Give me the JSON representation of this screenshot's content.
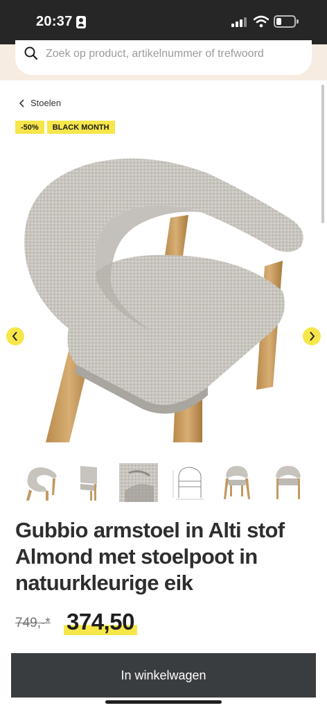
{
  "status_bar": {
    "time": "20:37"
  },
  "search": {
    "placeholder": "Zoek op product, artikelnummer of trefwoord"
  },
  "breadcrumb": {
    "label": "Stoelen"
  },
  "badges": {
    "discount": "-50%",
    "campaign": "BLACK MONTH"
  },
  "gallery": {
    "image_alt": "Gubbio armstoel",
    "thumbnail_count": 6,
    "thumbnails": [
      "chair-front-angle",
      "chair-side-cropped",
      "fabric-closeup",
      "chair-dimension-sketch",
      "chair-front-wide",
      "chair-front-straight"
    ]
  },
  "product": {
    "title": "Gubbio armstoel in Alti stof Almond met stoelpoot in natuurkleurige eik",
    "old_price": "749,-*",
    "new_price": "374,50"
  },
  "cta": {
    "add_to_cart_label": "In winkelwagen"
  },
  "colors": {
    "accent_yellow": "#f6e64a",
    "status_bar": "#262626",
    "search_band": "#f7ece1",
    "cta_background": "#3a3d40"
  }
}
